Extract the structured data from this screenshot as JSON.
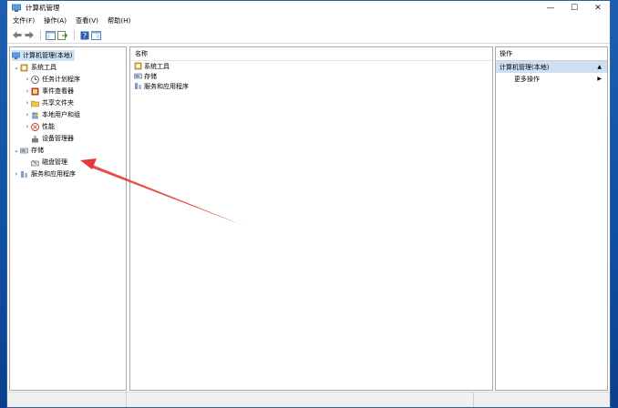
{
  "window": {
    "title": "计算机管理"
  },
  "menu": [
    "文件(F)",
    "操作(A)",
    "查看(V)",
    "帮助(H)"
  ],
  "tree": {
    "root": "计算机管理(本地)",
    "system_tools": "系统工具",
    "task_scheduler": "任务计划程序",
    "event_viewer": "事件查看器",
    "shared_folders": "共享文件夹",
    "local_users": "本地用户和组",
    "performance": "性能",
    "device_manager": "设备管理器",
    "storage": "存储",
    "disk_management": "磁盘管理",
    "services_apps": "服务和应用程序"
  },
  "middle": {
    "column_header": "名称",
    "items": [
      "系统工具",
      "存储",
      "服务和应用程序"
    ]
  },
  "actions": {
    "header": "操作",
    "band": "计算机管理(本地)",
    "more": "更多操作"
  },
  "colors": {
    "selection": "#cce4f7",
    "action_band": "#cfdff3",
    "arrow": "#e53935"
  }
}
